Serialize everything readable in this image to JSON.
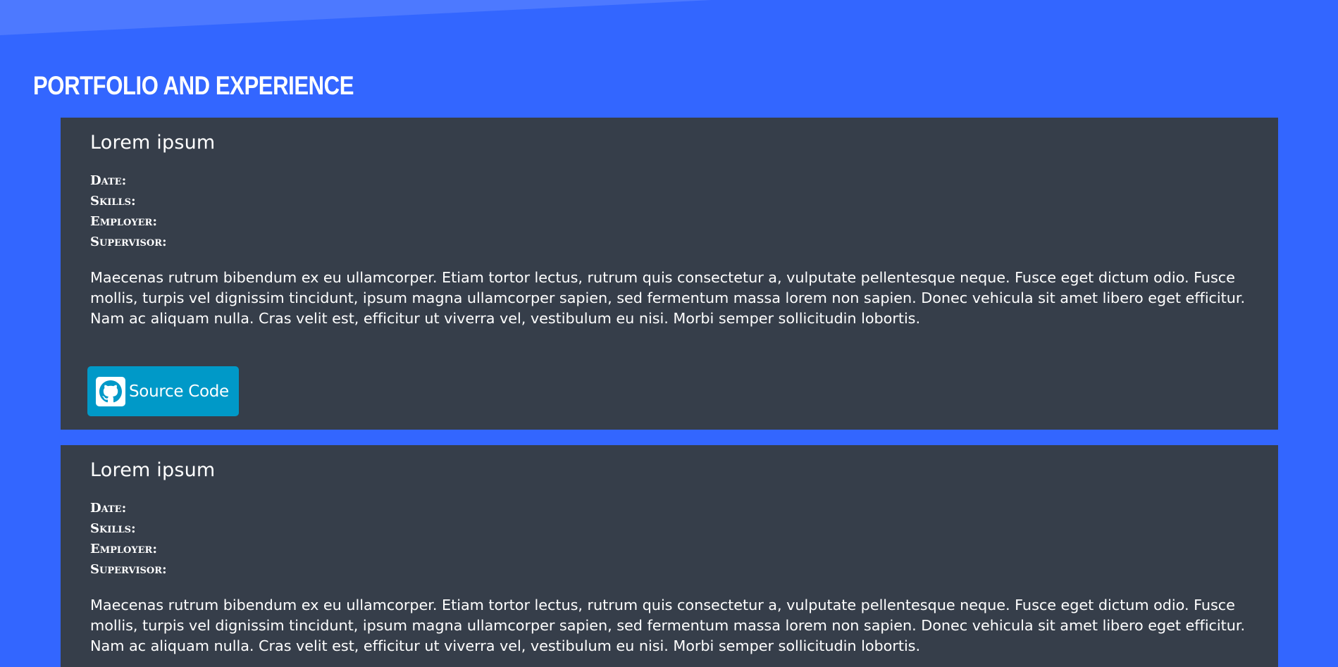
{
  "section": {
    "title": "Portfolio and Experience"
  },
  "colors": {
    "background": "#3366ff",
    "card": "#363e4a",
    "button": "#0099c8",
    "text": "#ffffff"
  },
  "cards": [
    {
      "title": "Lorem ipsum",
      "meta": {
        "date_label": "Date:",
        "skills_label": "Skills:",
        "employer_label": "Employer:",
        "supervisor_label": "Supervisor:"
      },
      "description": "Maecenas rutrum bibendum ex eu ullamcorper. Etiam tortor lectus, rutrum quis consectetur a, vulputate pellentesque neque. Fusce eget dictum odio. Fusce mollis, turpis vel dignissim tincidunt, ipsum magna ullamcorper sapien, sed fermentum massa lorem non sapien. Donec vehicula sit amet libero eget efficitur. Nam ac aliquam nulla. Cras velit est, efficitur ut viverra vel, vestibulum eu nisi. Morbi semper sollicitudin lobortis.",
      "button": {
        "label": "Source Code",
        "icon": "github-icon"
      }
    },
    {
      "title": "Lorem ipsum",
      "meta": {
        "date_label": "Date:",
        "skills_label": "Skills:",
        "employer_label": "Employer:",
        "supervisor_label": "Supervisor:"
      },
      "description": "Maecenas rutrum bibendum ex eu ullamcorper. Etiam tortor lectus, rutrum quis consectetur a, vulputate pellentesque neque. Fusce eget dictum odio. Fusce mollis, turpis vel dignissim tincidunt, ipsum magna ullamcorper sapien, sed fermentum massa lorem non sapien. Donec vehicula sit amet libero eget efficitur. Nam ac aliquam nulla. Cras velit est, efficitur ut viverra vel, vestibulum eu nisi. Morbi semper sollicitudin lobortis."
    }
  ]
}
